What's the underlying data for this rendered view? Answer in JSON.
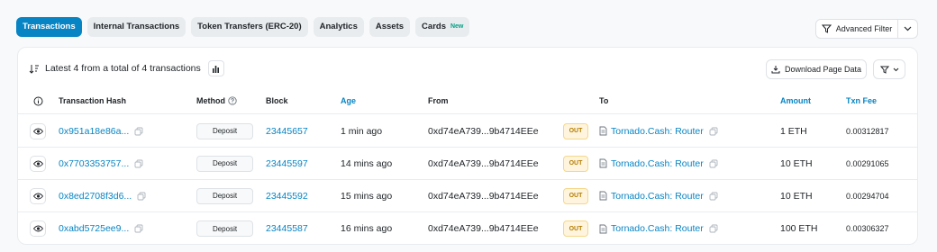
{
  "tabs": [
    {
      "label": "Transactions",
      "active": true
    },
    {
      "label": "Internal Transactions"
    },
    {
      "label": "Token Transfers (ERC-20)"
    },
    {
      "label": "Analytics"
    },
    {
      "label": "Assets"
    },
    {
      "label": "Cards",
      "badge": "New"
    }
  ],
  "toolbar": {
    "advanced_filter_label": "Advanced Filter",
    "summary": "Latest 4 from a total of 4 transactions",
    "download_label": "Download Page Data"
  },
  "columns": {
    "hash": "Transaction Hash",
    "method": "Method",
    "block": "Block",
    "age": "Age",
    "from": "From",
    "to": "To",
    "amount": "Amount",
    "fee": "Txn Fee"
  },
  "rows": [
    {
      "hash": "0x951a18e86a...",
      "method": "Deposit",
      "block": "23445657",
      "age": "1 min ago",
      "from": "0xd74eA739...9b4714EEe",
      "direction": "OUT",
      "to": "Tornado.Cash: Router",
      "amount": "1 ETH",
      "fee": "0.00312817"
    },
    {
      "hash": "0x7703353757...",
      "method": "Deposit",
      "block": "23445597",
      "age": "14 mins ago",
      "from": "0xd74eA739...9b4714EEe",
      "direction": "OUT",
      "to": "Tornado.Cash: Router",
      "amount": "10 ETH",
      "fee": "0.00291065"
    },
    {
      "hash": "0x8ed2708f3d6...",
      "method": "Deposit",
      "block": "23445592",
      "age": "15 mins ago",
      "from": "0xd74eA739...9b4714EEe",
      "direction": "OUT",
      "to": "Tornado.Cash: Router",
      "amount": "10 ETH",
      "fee": "0.00294704"
    },
    {
      "hash": "0xabd5725ee9...",
      "method": "Deposit",
      "block": "23445587",
      "age": "16 mins ago",
      "from": "0xd74eA739...9b4714EEe",
      "direction": "OUT",
      "to": "Tornado.Cash: Router",
      "amount": "100 ETH",
      "fee": "0.00306327"
    }
  ],
  "colors": {
    "accent": "#0784c3",
    "out_badge": "#b47d00"
  }
}
